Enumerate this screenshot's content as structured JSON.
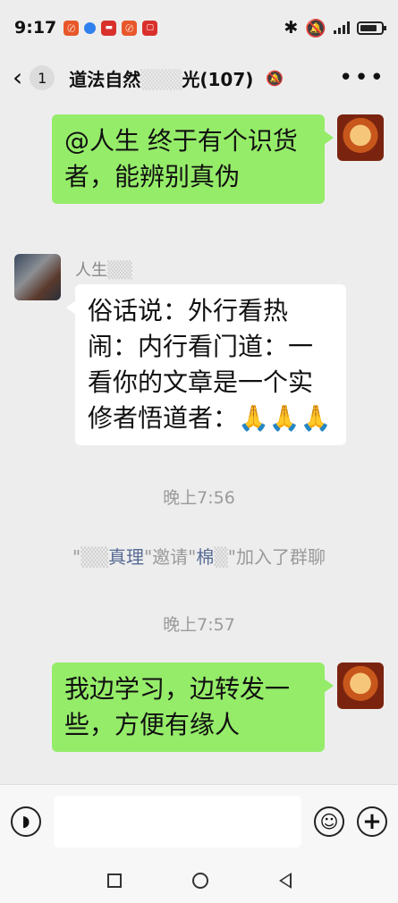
{
  "status_bar": {
    "time": "9:17",
    "app_badges": [
      "app-badge-orange",
      "app-badge-blue",
      "app-badge-red-1",
      "app-badge-red-2",
      "app-badge-red-3"
    ],
    "icons": [
      "bluetooth-icon",
      "mute-icon",
      "signal-icon",
      "battery-icon"
    ]
  },
  "header": {
    "back_icon": "chevron-left-icon",
    "unread_count": "1",
    "title": "道法自然",
    "title_suffix": "光(107)",
    "mute_icon": "bell-mute-icon",
    "more_icon": "more-dots-icon"
  },
  "messages": [
    {
      "from": "self",
      "text": "@人生  终于有个识货者，能辨别真伪"
    },
    {
      "from": "other",
      "sender": "人生",
      "text": "俗话说：外行看热闹：内行看门道：一看你的文章是一个实修者悟道者：🙏🙏🙏"
    },
    {
      "type": "time",
      "text": "晚上7:56"
    },
    {
      "type": "system",
      "inviter": "\"",
      "inviter_name": "真理",
      "mid": "\"邀请\"",
      "invitee_name": "棉",
      "end": "\"加入了群聊"
    },
    {
      "type": "time",
      "text": "晚上7:57"
    },
    {
      "from": "self",
      "text": "我边学习，边转发一些，方便有缘人"
    }
  ],
  "input_bar": {
    "voice_icon": "voice-icon",
    "emoji_icon": "emoji-icon",
    "plus_icon": "plus-icon",
    "input_value": ""
  },
  "nav_bar": {
    "icons": [
      "square-recent-icon",
      "circle-home-icon",
      "triangle-back-icon"
    ]
  },
  "colors": {
    "self_bubble": "#95ec69",
    "other_bubble": "#ffffff",
    "background": "#ededed",
    "link": "#576b95"
  }
}
